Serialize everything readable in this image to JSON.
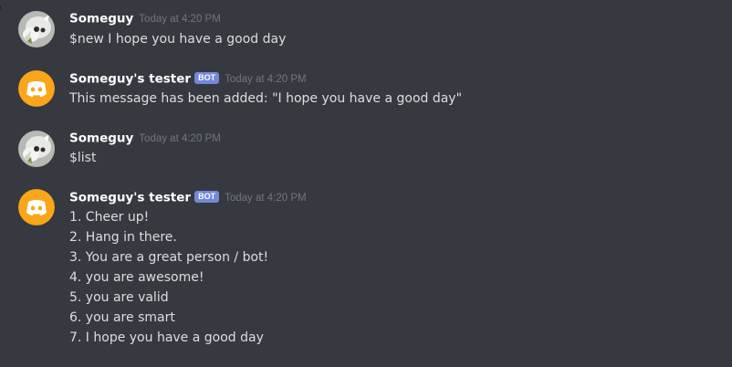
{
  "messages": [
    {
      "author": "Someguy",
      "is_bot": false,
      "timestamp": "Today at 4:20 PM",
      "avatar_icon": "user-avatar",
      "lines": [
        "$new I hope you have a good day"
      ]
    },
    {
      "author": "Someguy's tester",
      "is_bot": true,
      "bot_tag": "BOT",
      "timestamp": "Today at 4:20 PM",
      "avatar_icon": "discord-logo-icon",
      "lines": [
        "This message has been added: \"I hope you have a good day\""
      ]
    },
    {
      "author": "Someguy",
      "is_bot": false,
      "timestamp": "Today at 4:20 PM",
      "avatar_icon": "user-avatar",
      "lines": [
        "$list"
      ]
    },
    {
      "author": "Someguy's tester",
      "is_bot": true,
      "bot_tag": "BOT",
      "timestamp": "Today at 4:20 PM",
      "avatar_icon": "discord-logo-icon",
      "lines": [
        "1. Cheer up!",
        "2. Hang in there.",
        "3. You are a great person / bot!",
        "4. you are awesome!",
        "5. you are valid",
        "6. you are smart",
        "7. I hope you have a good day"
      ]
    }
  ],
  "colors": {
    "background": "#36393f",
    "username": "#ffffff",
    "message_text": "#dcddde",
    "timestamp": "#72767d",
    "bot_tag": "#7289da",
    "bot_avatar": "#faa61a"
  }
}
